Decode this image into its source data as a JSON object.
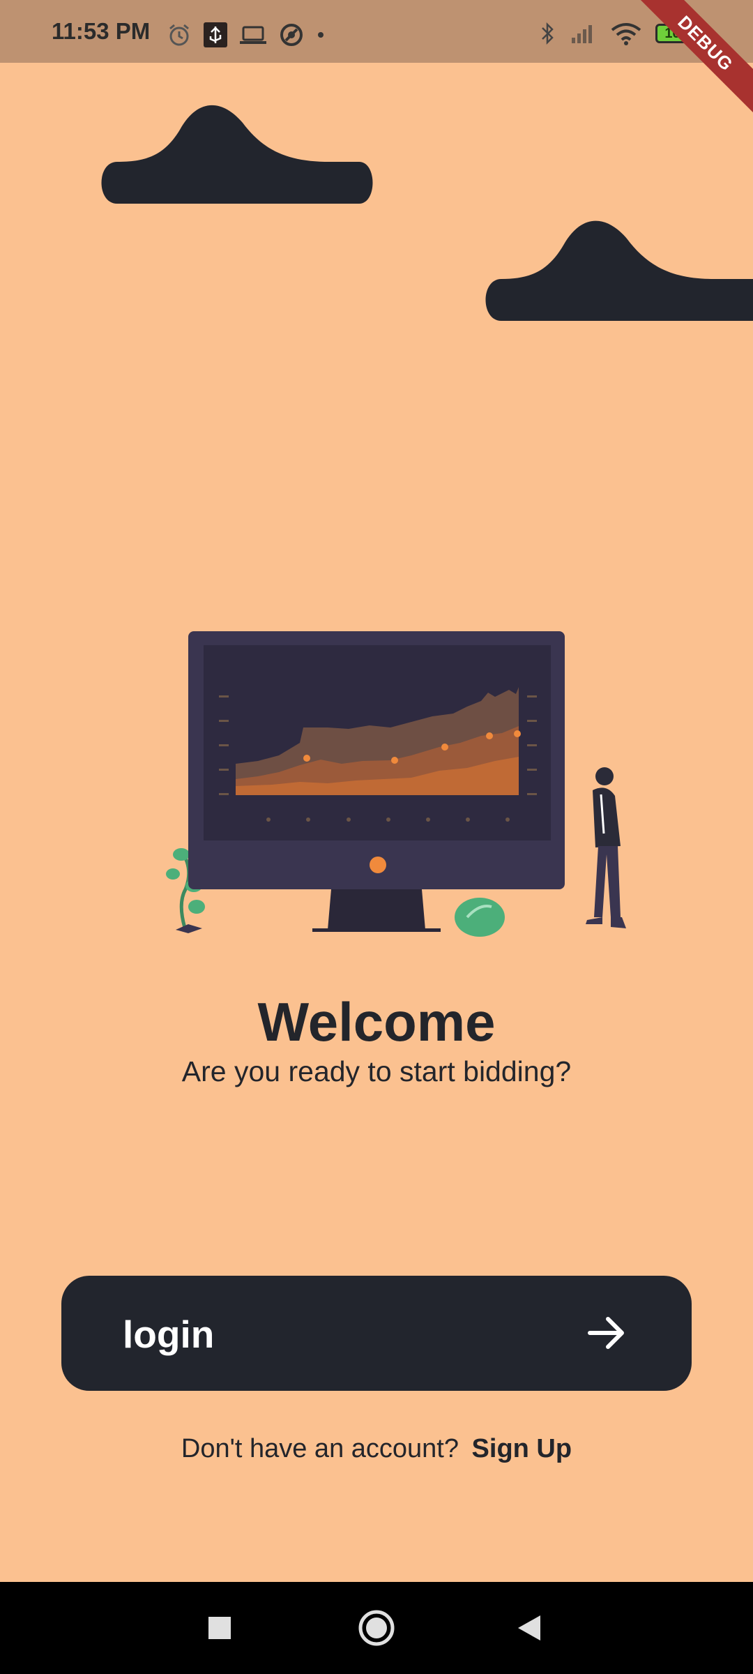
{
  "status_bar": {
    "time": "11:53 PM",
    "left_icons": [
      "alarm-icon",
      "usb-debug-icon",
      "laptop-icon",
      "sync-icon",
      "dot-icon"
    ],
    "right_icons": [
      "bluetooth-icon",
      "signal-icon",
      "wifi-icon"
    ],
    "battery_level": "100"
  },
  "debug_banner": "DEBUG",
  "welcome": {
    "title": "Welcome",
    "subtitle": "Are you ready to start bidding?"
  },
  "login_button": {
    "label": "login",
    "icon": "arrow-right-icon"
  },
  "signup": {
    "prompt": "Don't have an account?",
    "link": "Sign Up"
  },
  "nav_bar": {
    "buttons": [
      "recents-square-icon",
      "home-circle-icon",
      "back-triangle-icon"
    ]
  },
  "colors": {
    "background": "#FBC190",
    "status_bar": "#BE9271",
    "dark": "#22252D",
    "accent_orange": "#F08A3C",
    "plant_green": "#4CAF7A"
  }
}
